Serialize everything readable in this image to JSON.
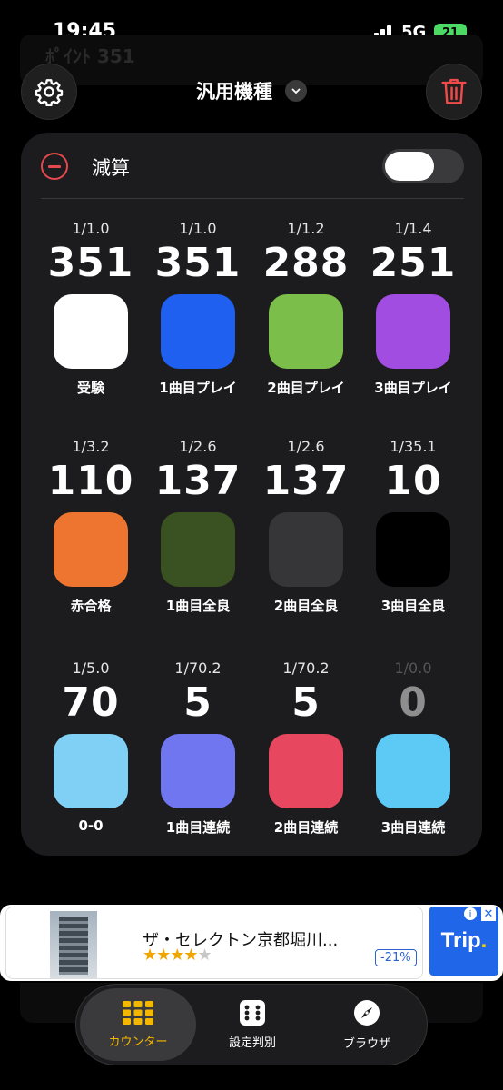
{
  "status_bar": {
    "time": "19:45",
    "network": "5G",
    "battery": "21"
  },
  "ghost": {
    "text": "ﾎﾟｲﾝﾄ  351"
  },
  "header": {
    "title": "汎用機種",
    "settings_icon": "gear-icon",
    "delete_icon": "trash-icon",
    "dropdown_icon": "chevron-down-icon"
  },
  "card": {
    "subtract_label": "減算",
    "subtract_toggle_on": false,
    "counters": [
      {
        "ratio": "1/1.0",
        "count": "351",
        "name": "受験",
        "color": "#ffffff"
      },
      {
        "ratio": "1/1.0",
        "count": "351",
        "name": "1曲目プレイ",
        "color": "#2060f0"
      },
      {
        "ratio": "1/1.2",
        "count": "288",
        "name": "2曲目プレイ",
        "color": "#7bbf4a"
      },
      {
        "ratio": "1/1.4",
        "count": "251",
        "name": "3曲目プレイ",
        "color": "#a24de2"
      },
      {
        "ratio": "1/3.2",
        "count": "110",
        "name": "赤合格",
        "color": "#ee7530"
      },
      {
        "ratio": "1/2.6",
        "count": "137",
        "name": "1曲目全良",
        "color": "#3a5221"
      },
      {
        "ratio": "1/2.6",
        "count": "137",
        "name": "2曲目全良",
        "color": "#363638"
      },
      {
        "ratio": "1/35.1",
        "count": "10",
        "name": "3曲目全良",
        "color": "#000000"
      },
      {
        "ratio": "1/5.0",
        "count": "70",
        "name": "0-0",
        "color": "#80cff5"
      },
      {
        "ratio": "1/70.2",
        "count": "5",
        "name": "1曲目連続",
        "color": "#7076f0"
      },
      {
        "ratio": "1/70.2",
        "count": "5",
        "name": "2曲目連続",
        "color": "#e7475f"
      },
      {
        "ratio": "1/0.0",
        "count": "0",
        "name": "3曲目連続",
        "color": "#5ccaf5",
        "dimmed": true
      }
    ]
  },
  "ad": {
    "title": "ザ・セレクトン京都堀川...",
    "stars_filled": "★★★★",
    "stars_empty": "★",
    "rating": 4,
    "discount": "-21%",
    "logo_text": "Trip",
    "logo_dot": ".",
    "info_icon": "info-icon",
    "close_icon": "close-icon"
  },
  "tabs": [
    {
      "label": "カウンター",
      "icon": "grid-icon",
      "active": true
    },
    {
      "label": "設定判別",
      "icon": "dice-icon",
      "active": false
    },
    {
      "label": "ブラウザ",
      "icon": "compass-icon",
      "active": false
    }
  ]
}
